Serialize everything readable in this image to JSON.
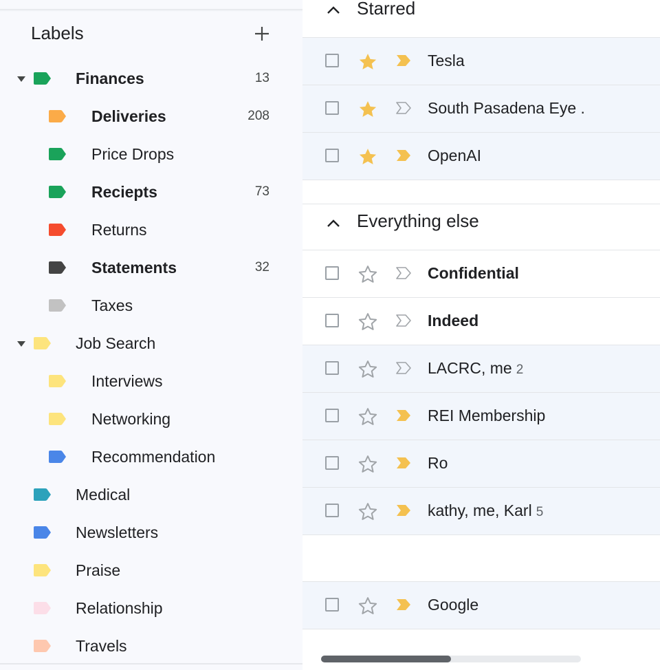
{
  "sidebar": {
    "title": "Labels",
    "labels": [
      {
        "name": "Finances",
        "count": "13",
        "color": "#1aa35a",
        "level": 0,
        "bold": true,
        "caret": true
      },
      {
        "name": "Deliveries",
        "count": "208",
        "color": "#fbab48",
        "level": 1,
        "bold": true
      },
      {
        "name": "Price Drops",
        "count": "",
        "color": "#1aa35a",
        "level": 1,
        "bold": false
      },
      {
        "name": "Reciepts",
        "count": "73",
        "color": "#1aa35a",
        "level": 1,
        "bold": true
      },
      {
        "name": "Returns",
        "count": "",
        "color": "#f54c2e",
        "level": 1,
        "bold": false
      },
      {
        "name": "Statements",
        "count": "32",
        "color": "#444444",
        "level": 1,
        "bold": true
      },
      {
        "name": "Taxes",
        "count": "",
        "color": "#c2c2c2",
        "level": 1,
        "bold": false
      },
      {
        "name": "Job Search",
        "count": "",
        "color": "#fde47d",
        "level": 0,
        "bold": false,
        "caret": true
      },
      {
        "name": "Interviews",
        "count": "",
        "color": "#fde47d",
        "level": 1,
        "bold": false
      },
      {
        "name": "Networking",
        "count": "",
        "color": "#fde47d",
        "level": 1,
        "bold": false
      },
      {
        "name": "Recommendation",
        "count": "",
        "color": "#4a86e8",
        "level": 1,
        "bold": false
      },
      {
        "name": "Medical",
        "count": "",
        "color": "#2da2bb",
        "level": 0,
        "bold": false
      },
      {
        "name": "Newsletters",
        "count": "",
        "color": "#4a86e8",
        "level": 0,
        "bold": false
      },
      {
        "name": "Praise",
        "count": "",
        "color": "#fde47d",
        "level": 0,
        "bold": false
      },
      {
        "name": "Relationship",
        "count": "",
        "color": "#fcdee8",
        "level": 0,
        "bold": false
      },
      {
        "name": "Travels",
        "count": "",
        "color": "#fec8af",
        "level": 0,
        "bold": false
      }
    ]
  },
  "main": {
    "sections": [
      {
        "title": "Starred",
        "rows": [
          {
            "sender": "Tesla",
            "count": "",
            "starred": true,
            "important": true,
            "unread": false
          },
          {
            "sender": "South Pasadena Eye .",
            "count": "",
            "starred": true,
            "important": false,
            "unread": false
          },
          {
            "sender": "OpenAI",
            "count": "",
            "starred": true,
            "important": true,
            "unread": false
          }
        ]
      },
      {
        "title": "Everything else",
        "rows": [
          {
            "sender": "Confidential",
            "count": "",
            "starred": false,
            "important": false,
            "unread": true
          },
          {
            "sender": "Indeed",
            "count": "",
            "starred": false,
            "important": false,
            "unread": true
          },
          {
            "sender": "LACRC, me",
            "count": "2",
            "starred": false,
            "important": false,
            "unread": false
          },
          {
            "sender": "REI Membership",
            "count": "",
            "starred": false,
            "important": true,
            "unread": false
          },
          {
            "sender": "Ro",
            "count": "",
            "starred": false,
            "important": true,
            "unread": false
          },
          {
            "sender": "kathy, me, Karl",
            "count": "5",
            "starred": false,
            "important": true,
            "unread": false
          },
          {
            "sender": "Google",
            "count": "",
            "starred": false,
            "important": true,
            "unread": false
          }
        ]
      }
    ],
    "scroll_position": 0.5
  },
  "colors": {
    "star": "#f4c150",
    "important": "#f4c150",
    "unread_bg": "#ffffff",
    "read_bg": "#f2f6fc"
  }
}
